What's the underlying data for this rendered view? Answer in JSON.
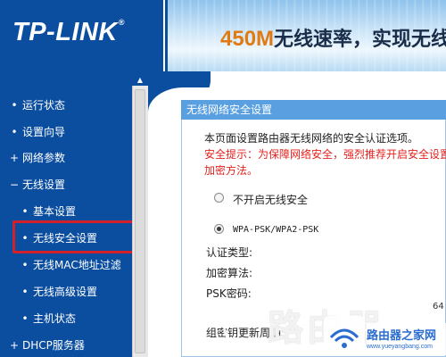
{
  "header": {
    "logo": "TP-LINK",
    "logo_reg": "®",
    "banner_speed": "450M",
    "banner_text": "无线速率，实现无线"
  },
  "sidebar": {
    "items": [
      {
        "label": "运行状态",
        "bullet": "•"
      },
      {
        "label": "设置向导",
        "bullet": "•"
      },
      {
        "label": "网络参数",
        "bullet": "+"
      },
      {
        "label": "无线设置",
        "bullet": "−"
      },
      {
        "label": "基本设置",
        "bullet": "•"
      },
      {
        "label": "无线安全设置",
        "bullet": "•"
      },
      {
        "label": "无线MAC地址过滤",
        "bullet": "•"
      },
      {
        "label": "无线高级设置",
        "bullet": "•"
      },
      {
        "label": "主机状态",
        "bullet": "•"
      },
      {
        "label": "DHCP服务器",
        "bullet": "+"
      }
    ]
  },
  "panel": {
    "title": "无线网络安全设置",
    "description": "本页面设置路由器无线网络的安全认证选项。",
    "warning_line1": "安全提示：为保障网络安全，强烈推荐开启安全设置",
    "warning_line2": "加密方法。",
    "option_off": "不开启无线安全",
    "option_wpa": "WPA-PSK/WPA2-PSK",
    "auth_label": "认证类型:",
    "encrypt_label": "加密算法:",
    "psk_label": "PSK密码:",
    "psk_value_partial": "64",
    "group_key_label": "组密钥更新周期:"
  },
  "watermark": {
    "big_text": "路由器",
    "brand": "路由器之家网",
    "url": "www.yueyangbang.com"
  },
  "colors": {
    "header_blue": "#0b4ea0",
    "panel_title": "#5aa0e0",
    "warning_red": "#e0241f",
    "highlight_red": "#d3202a",
    "banner_orange": "#e07a12"
  }
}
